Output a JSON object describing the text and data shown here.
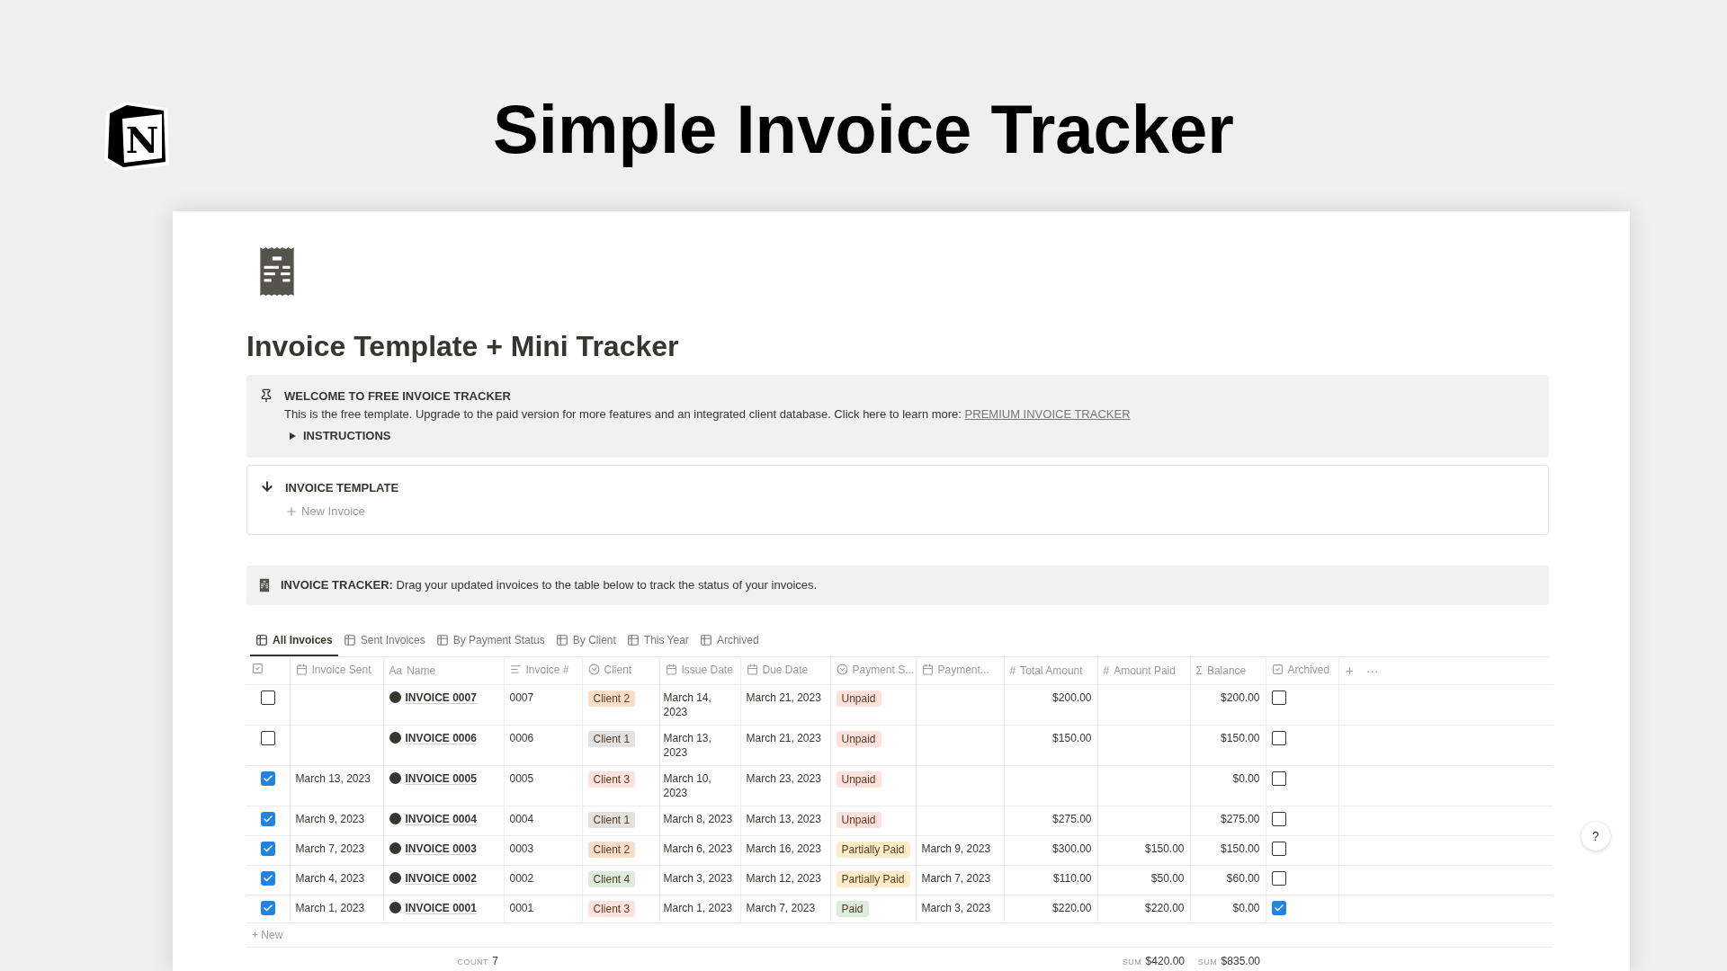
{
  "header": {
    "logo_letter": "N",
    "title": "Simple Invoice Tracker"
  },
  "page": {
    "title": "Invoice Template + Mini Tracker"
  },
  "welcome": {
    "title": "WELCOME TO FREE INVOICE TRACKER",
    "body": "This is the free template. Upgrade to the paid version for more features and an integrated client database. Click here to learn more:",
    "link": "PREMIUM INVOICE TRACKER",
    "toggle": {
      "label": "INSTRUCTIONS",
      "expanded": false
    }
  },
  "template": {
    "title": "INVOICE TEMPLATE",
    "button": "New Invoice"
  },
  "tracker": {
    "label": "INVOICE TRACKER:",
    "text": "Drag your updated invoices to the table below to track the status of your invoices."
  },
  "views": [
    {
      "label": "All Invoices",
      "selected": true
    },
    {
      "label": "Sent Invoices",
      "selected": false
    },
    {
      "label": "By Payment Status",
      "selected": false
    },
    {
      "label": "By Client",
      "selected": false
    },
    {
      "label": "This Year",
      "selected": false
    },
    {
      "label": "Archived",
      "selected": false
    }
  ],
  "columns": [
    {
      "kind": "checkbox"
    },
    {
      "kind": "date",
      "label": "Invoice Sent"
    },
    {
      "kind": "title",
      "glyph": "Aa",
      "label": "Name"
    },
    {
      "kind": "text",
      "label": "Invoice #"
    },
    {
      "kind": "select",
      "label": "Client"
    },
    {
      "kind": "date",
      "label": "Issue Date"
    },
    {
      "kind": "date",
      "label": "Due Date"
    },
    {
      "kind": "select",
      "label": "Payment S..."
    },
    {
      "kind": "date",
      "label": "Payment..."
    },
    {
      "kind": "number",
      "glyph": "#",
      "label": "Total Amount"
    },
    {
      "kind": "number",
      "glyph": "#",
      "label": "Amount Paid"
    },
    {
      "kind": "formula",
      "glyph": "Σ",
      "label": "Balance"
    },
    {
      "kind": "checkbox",
      "label": "Archived"
    }
  ],
  "add_column": {
    "plus": "+",
    "more": "···"
  },
  "rows": [
    {
      "sent": false,
      "name": "INVOICE 0007",
      "number": "0007",
      "client": {
        "label": "Client 2",
        "color": "#fadec9"
      },
      "issue_date": "March 14, 2023",
      "due_date": "March 21, 2023",
      "status": {
        "label": "Unpaid",
        "color": "#ffe2dd"
      },
      "total": "$200.00",
      "balance": "$200.00",
      "archived": false
    },
    {
      "sent": false,
      "name": "INVOICE 0006",
      "number": "0006",
      "client": {
        "label": "Client 1",
        "color": "#e3e2e0"
      },
      "issue_date": "March 13, 2023",
      "due_date": "March 21, 2023",
      "status": {
        "label": "Unpaid",
        "color": "#ffe2dd"
      },
      "total": "$150.00",
      "balance": "$150.00",
      "archived": false
    },
    {
      "sent": true,
      "invoice_sent": "March 13, 2023",
      "name": "INVOICE 0005",
      "number": "0005",
      "client": {
        "label": "Client 3",
        "color": "#ffe2dd"
      },
      "issue_date": "March 10, 2023",
      "due_date": "March 23, 2023",
      "status": {
        "label": "Unpaid",
        "color": "#ffe2dd"
      },
      "balance": "$0.00",
      "archived": false
    },
    {
      "sent": true,
      "invoice_sent": "March 9, 2023",
      "name": "INVOICE 0004",
      "number": "0004",
      "client": {
        "label": "Client 1",
        "color": "#e3e2e0"
      },
      "issue_date": "March 8, 2023",
      "due_date": "March 13, 2023",
      "status": {
        "label": "Unpaid",
        "color": "#ffe2dd"
      },
      "total": "$275.00",
      "balance": "$275.00",
      "archived": false
    },
    {
      "sent": true,
      "invoice_sent": "March 7, 2023",
      "name": "INVOICE 0003",
      "number": "0003",
      "client": {
        "label": "Client 2",
        "color": "#fadec9"
      },
      "issue_date": "March 6, 2023",
      "due_date": "March 16, 2023",
      "status": {
        "label": "Partially Paid",
        "color": "#fdecc8"
      },
      "payment_date": "March 9, 2023",
      "total": "$300.00",
      "paid": "$150.00",
      "balance": "$150.00",
      "archived": false
    },
    {
      "sent": true,
      "invoice_sent": "March 4, 2023",
      "name": "INVOICE 0002",
      "number": "0002",
      "client": {
        "label": "Client 4",
        "color": "#dbeddb"
      },
      "issue_date": "March 3, 2023",
      "due_date": "March 12, 2023",
      "status": {
        "label": "Partially Paid",
        "color": "#fdecc8"
      },
      "payment_date": "March 7, 2023",
      "total": "$110.00",
      "paid": "$50.00",
      "balance": "$60.00",
      "archived": false
    },
    {
      "sent": true,
      "invoice_sent": "March 1, 2023",
      "name": "INVOICE 0001",
      "number": "0001",
      "client": {
        "label": "Client 3",
        "color": "#ffe2dd"
      },
      "issue_date": "March 1, 2023",
      "due_date": "March 7, 2023",
      "status": {
        "label": "Paid",
        "color": "#dbeddb"
      },
      "payment_date": "March 3, 2023",
      "total": "$220.00",
      "paid": "$220.00",
      "balance": "$0.00",
      "archived": true
    }
  ],
  "new_row": {
    "plus": "+",
    "label": "New"
  },
  "footer": {
    "count": {
      "label": "COUNT",
      "value": "7"
    },
    "paid_sum": {
      "label": "SUM",
      "value": "$420.00"
    },
    "balance_sum": {
      "label": "SUM",
      "value": "$835.00"
    }
  },
  "help": {
    "label": "?"
  }
}
